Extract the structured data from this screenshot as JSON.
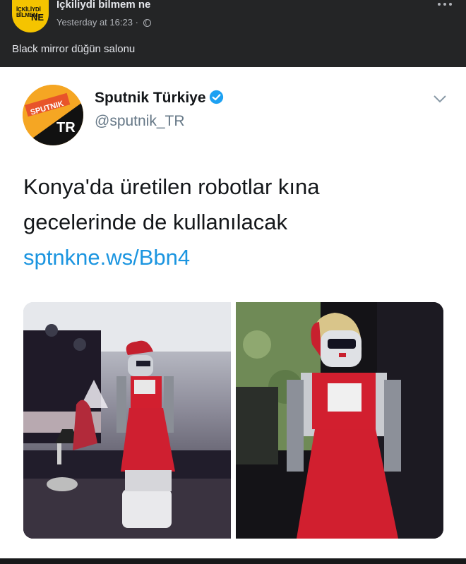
{
  "post": {
    "page_name": "İçkiliydi bilmem ne",
    "logo_text_line1": "İÇKİLİYDİ",
    "logo_text_line2": "BİLMEM",
    "logo_text_ne": "NE",
    "timestamp": "Yesterday at 16:23",
    "separator": "·",
    "text": "Black mirror düğün salonu",
    "icons": {
      "privacy": "globe-icon",
      "menu": "more-icon"
    }
  },
  "tweet": {
    "account_name": "Sputnik Türkiye",
    "handle": "@sputnik_TR",
    "avatar_text_top": "SPUTNIK",
    "avatar_text_bottom": "TR",
    "text_line1": "Konya'da üretilen robotlar kına",
    "text_line2": "gecelerinde de kullanılacak",
    "link": "sptnkne.ws/Bbn4",
    "icons": {
      "verified": "verified-icon",
      "menu": "chevron-down-icon"
    }
  },
  "colors": {
    "header_bg": "#242526",
    "page_bg": "#18191a",
    "link_blue": "#1b95e0",
    "verified_blue": "#1da1f2",
    "logo_yellow": "#f5c400",
    "sputnik_orange": "#f5a623"
  }
}
